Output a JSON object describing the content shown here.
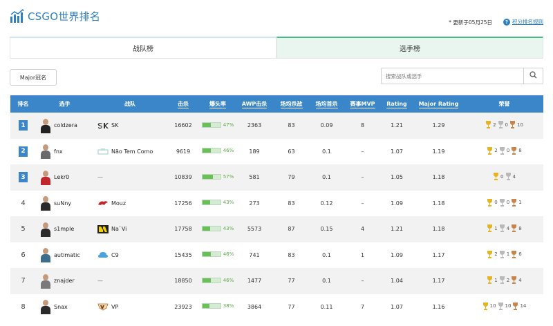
{
  "header": {
    "title": "CSGO世界排名",
    "update_text": "* 更新于05月25日",
    "help_label": "积分排名规则"
  },
  "tabs": [
    {
      "label": "战队榜",
      "active": false
    },
    {
      "label": "选手榜",
      "active": true
    }
  ],
  "filter": {
    "major_label": "Major冠名"
  },
  "search": {
    "placeholder": "搜索战队或选手"
  },
  "table": {
    "columns": [
      "排名",
      "选手",
      "战队",
      "击杀",
      "爆头率",
      "AWP击杀",
      "场均杀敌",
      "场均首杀",
      "赛事MVP",
      "Rating",
      "Major Rating",
      "荣誉"
    ],
    "rows": [
      {
        "rank": "1",
        "name": "coldzera",
        "team": "SK",
        "kills": "16602",
        "hs": "47%",
        "hs_pct": 47,
        "awp": "2363",
        "avg_kills": "83",
        "first_kills": "0.09",
        "mvp": "8",
        "rating": "1.21",
        "major_rating": "1.29",
        "gold": "2",
        "silver": "0",
        "bronze": "10",
        "jersey": "#222222"
      },
      {
        "rank": "2",
        "name": "fnx",
        "team": "Não Tem Como",
        "kills": "9619",
        "hs": "46%",
        "hs_pct": 46,
        "awp": "189",
        "avg_kills": "63",
        "first_kills": "0.1",
        "mvp": "–",
        "rating": "1.07",
        "major_rating": "1.19",
        "gold": "2",
        "silver": "0",
        "bronze": "8",
        "jersey": "#6a6a6a"
      },
      {
        "rank": "3",
        "name": "Lekr0",
        "team": "—",
        "kills": "10839",
        "hs": "57%",
        "hs_pct": 57,
        "awp": "581",
        "avg_kills": "79",
        "first_kills": "0.1",
        "mvp": "–",
        "rating": "1.05",
        "major_rating": "1.18",
        "gold": "0",
        "silver": "4",
        "bronze": "",
        "jersey": "#c0272d"
      },
      {
        "rank": "4",
        "name": "suNny",
        "team": "Mouz",
        "kills": "17256",
        "hs": "43%",
        "hs_pct": 43,
        "awp": "273",
        "avg_kills": "83",
        "first_kills": "0.12",
        "mvp": "–",
        "rating": "1.09",
        "major_rating": "1.18",
        "gold": "0",
        "silver": "0",
        "bronze": "1",
        "jersey": "#2b2b2b"
      },
      {
        "rank": "5",
        "name": "s1mple",
        "team": "Na`Vi",
        "kills": "17758",
        "hs": "43%",
        "hs_pct": 43,
        "awp": "5573",
        "avg_kills": "87",
        "first_kills": "0.15",
        "mvp": "4",
        "rating": "1.21",
        "major_rating": "1.18",
        "gold": "1",
        "silver": "4",
        "bronze": "8",
        "jersey": "#2b2b2b"
      },
      {
        "rank": "6",
        "name": "autimatic",
        "team": "C9",
        "kills": "15435",
        "hs": "46%",
        "hs_pct": 46,
        "awp": "741",
        "avg_kills": "83",
        "first_kills": "0.1",
        "mvp": "1",
        "rating": "1.09",
        "major_rating": "1.17",
        "gold": "2",
        "silver": "1",
        "bronze": "6",
        "jersey": "#3f6e8c"
      },
      {
        "rank": "7",
        "name": "znajder",
        "team": "—",
        "kills": "18850",
        "hs": "46%",
        "hs_pct": 46,
        "awp": "1477",
        "avg_kills": "77",
        "first_kills": "0.1",
        "mvp": "–",
        "rating": "1.04",
        "major_rating": "1.17",
        "gold": "1",
        "silver": "2",
        "bronze": "4",
        "jersey": "#7a7a7a"
      },
      {
        "rank": "8",
        "name": "Snax",
        "team": "VP",
        "kills": "23923",
        "hs": "38%",
        "hs_pct": 38,
        "awp": "3864",
        "avg_kills": "77",
        "first_kills": "0.11",
        "mvp": "7",
        "rating": "1.07",
        "major_rating": "1.16",
        "gold": "10",
        "silver": "10",
        "bronze": "14",
        "jersey": "#2b2b2b"
      }
    ]
  },
  "colors": {
    "accent": "#3a86c8",
    "header_row": "#3a86c8",
    "active_tab": "#e9f6f0",
    "hs_bar": "#6bbf59",
    "gold": "#e6b422",
    "silver": "#b9b9b9",
    "bronze": "#c8844a"
  }
}
